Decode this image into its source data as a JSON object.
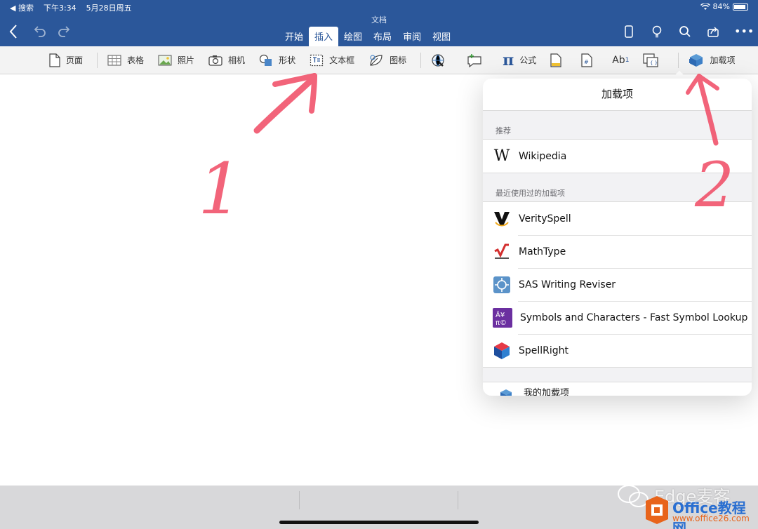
{
  "status_bar": {
    "back_app": "◀ 搜索",
    "time": "下午3:34",
    "date": "5月28日周五",
    "battery": "84%"
  },
  "document": {
    "title": "文档"
  },
  "tabs": [
    {
      "label": "开始"
    },
    {
      "label": "插入",
      "active": true
    },
    {
      "label": "绘图"
    },
    {
      "label": "布局"
    },
    {
      "label": "审阅"
    },
    {
      "label": "视图"
    }
  ],
  "header_icons": [
    "phone-icon",
    "lightbulb-icon",
    "search-icon",
    "share-icon",
    "more-icon"
  ],
  "ribbon": {
    "page": "页面",
    "table": "表格",
    "photo": "照片",
    "camera": "相机",
    "shape": "形状",
    "textbox": "文本框",
    "icon": "图标",
    "equation": "公式",
    "footnote": "Ab",
    "footnote_sup": "1",
    "addins": "加载项"
  },
  "addins_panel": {
    "title": "加载项",
    "recommended_heading": "推荐",
    "recommended": [
      {
        "name": "Wikipedia"
      }
    ],
    "recent_heading": "最近使用过的加载项",
    "recent": [
      {
        "name": "VeritySpell"
      },
      {
        "name": "MathType"
      },
      {
        "name": "SAS Writing Reviser"
      },
      {
        "name": "Symbols and Characters - Fast Symbol Lookup"
      },
      {
        "name": "SpellRight"
      }
    ],
    "my_addins": "我的加载项"
  },
  "annotations": {
    "step1": "1",
    "step2": "2"
  },
  "watermark": {
    "line1": "Edge麦客",
    "line2": "Office教程网",
    "line3": "www.office26.com"
  },
  "colors": {
    "header": "#2b579a",
    "annotation": "#f04a63"
  }
}
